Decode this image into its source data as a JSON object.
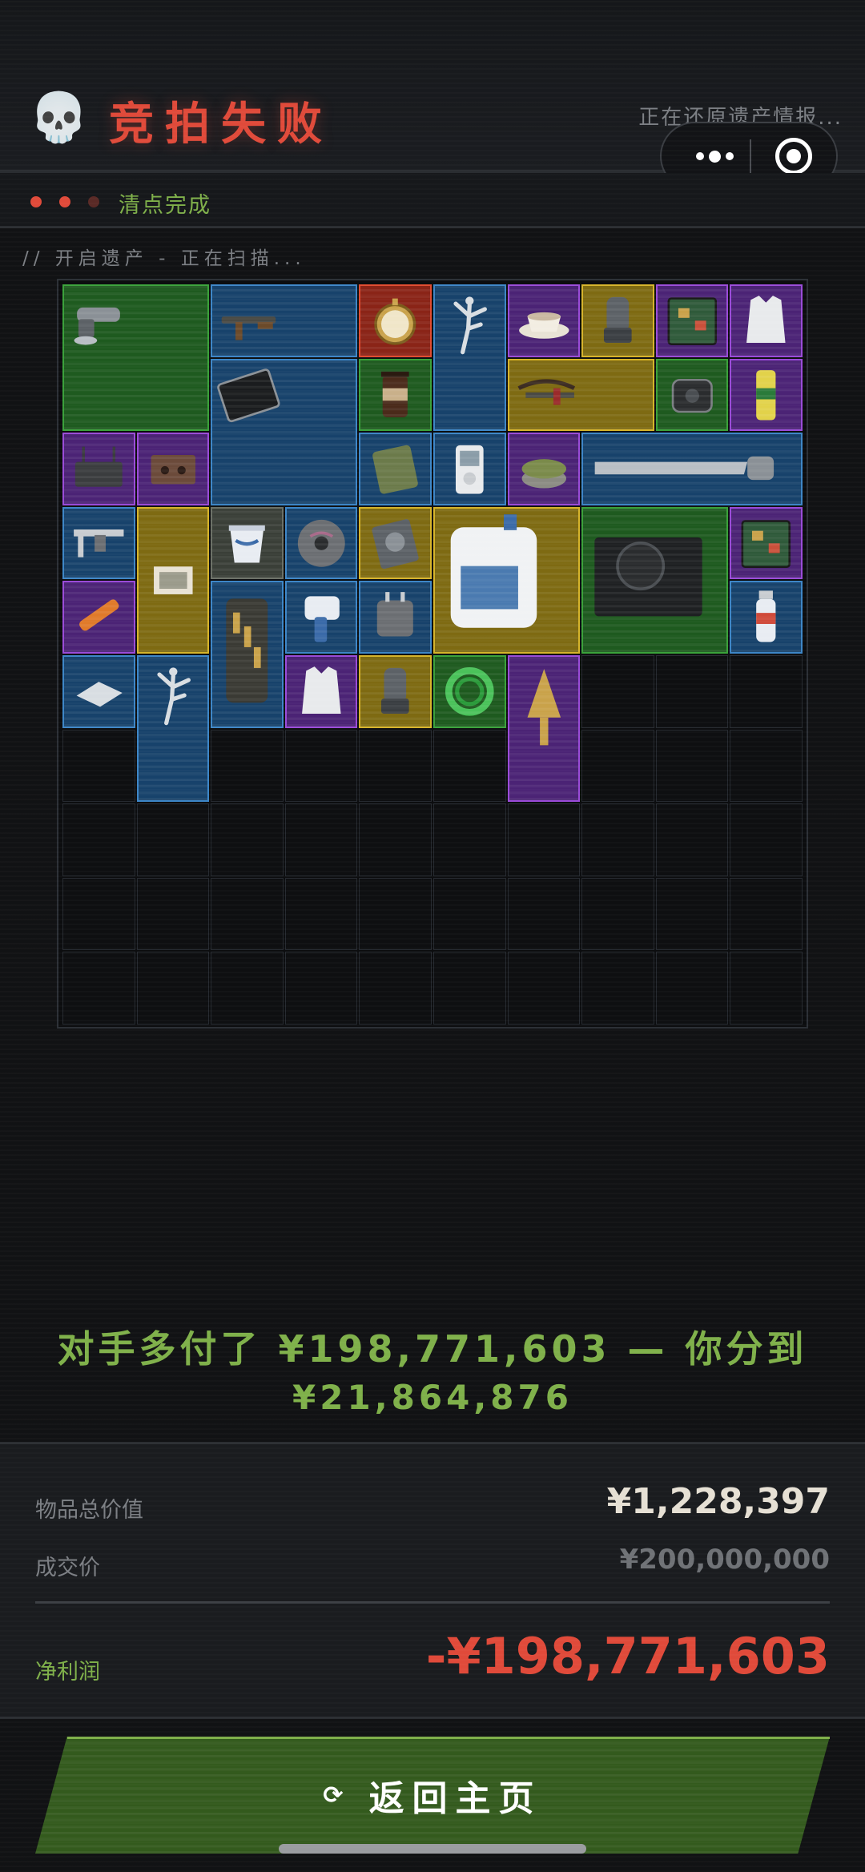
{
  "header": {
    "title": "竞拍失败",
    "skull_icon": "💀",
    "restore_status": "正在还原遗产情报..."
  },
  "status": {
    "text": "清点完成",
    "dot_colors": [
      "#e04a3a",
      "#e04a3a",
      "#5a2a26"
    ]
  },
  "scan_text": "// 开启遗产 - 正在扫描...",
  "inventory": {
    "columns": 10,
    "rows": 10,
    "items": [
      {
        "name": "angle-grinder",
        "rarity": "green",
        "col": 0,
        "row": 0,
        "w": 2,
        "h": 2
      },
      {
        "name": "assault-rifle",
        "rarity": "blue",
        "col": 2,
        "row": 0,
        "w": 2,
        "h": 1
      },
      {
        "name": "pocket-watch",
        "rarity": "red",
        "col": 4,
        "row": 0,
        "w": 1,
        "h": 1
      },
      {
        "name": "ballerina-statue",
        "rarity": "blue",
        "col": 5,
        "row": 0,
        "w": 1,
        "h": 2
      },
      {
        "name": "teacup",
        "rarity": "purple",
        "col": 6,
        "row": 0,
        "w": 1,
        "h": 1
      },
      {
        "name": "gas-mask-filter",
        "rarity": "gold",
        "col": 7,
        "row": 0,
        "w": 1,
        "h": 1
      },
      {
        "name": "circuit-board",
        "rarity": "purple",
        "col": 8,
        "row": 0,
        "w": 1,
        "h": 1
      },
      {
        "name": "body-armor-vest",
        "rarity": "purple",
        "col": 9,
        "row": 0,
        "w": 1,
        "h": 1
      },
      {
        "name": "tablet",
        "rarity": "blue",
        "col": 2,
        "row": 1,
        "w": 2,
        "h": 2
      },
      {
        "name": "coffee-jar",
        "rarity": "green",
        "col": 4,
        "row": 1,
        "w": 1,
        "h": 1
      },
      {
        "name": "crossbow",
        "rarity": "gold",
        "col": 6,
        "row": 1,
        "w": 2,
        "h": 1
      },
      {
        "name": "wireless-charger",
        "rarity": "green",
        "col": 8,
        "row": 1,
        "w": 1,
        "h": 1
      },
      {
        "name": "energy-drink-can",
        "rarity": "purple",
        "col": 9,
        "row": 1,
        "w": 1,
        "h": 1
      },
      {
        "name": "router",
        "rarity": "purple",
        "col": 0,
        "row": 2,
        "w": 1,
        "h": 1
      },
      {
        "name": "cassette-tape",
        "rarity": "purple",
        "col": 1,
        "row": 2,
        "w": 1,
        "h": 1
      },
      {
        "name": "ration-pack",
        "rarity": "blue",
        "col": 4,
        "row": 2,
        "w": 1,
        "h": 1
      },
      {
        "name": "mp3-player",
        "rarity": "blue",
        "col": 5,
        "row": 2,
        "w": 1,
        "h": 1
      },
      {
        "name": "canned-food",
        "rarity": "purple",
        "col": 6,
        "row": 2,
        "w": 1,
        "h": 1
      },
      {
        "name": "hand-saw",
        "rarity": "blue",
        "col": 7,
        "row": 2,
        "w": 3,
        "h": 1
      },
      {
        "name": "caliper",
        "rarity": "blue",
        "col": 0,
        "row": 3,
        "w": 1,
        "h": 1
      },
      {
        "name": "document-photo",
        "rarity": "gold",
        "col": 1,
        "row": 3,
        "w": 1,
        "h": 2
      },
      {
        "name": "yogurt-cup",
        "rarity": "gray",
        "col": 2,
        "row": 3,
        "w": 1,
        "h": 1
      },
      {
        "name": "cd-disc",
        "rarity": "blue",
        "col": 3,
        "row": 3,
        "w": 1,
        "h": 1
      },
      {
        "name": "hard-drive",
        "rarity": "gold",
        "col": 4,
        "row": 3,
        "w": 1,
        "h": 1
      },
      {
        "name": "fuel-jug",
        "rarity": "gold",
        "col": 5,
        "row": 3,
        "w": 2,
        "h": 2
      },
      {
        "name": "power-supply",
        "rarity": "green",
        "col": 7,
        "row": 3,
        "w": 2,
        "h": 2
      },
      {
        "name": "circuit-board",
        "rarity": "purple",
        "col": 9,
        "row": 3,
        "w": 1,
        "h": 1
      },
      {
        "name": "flare-tube",
        "rarity": "purple",
        "col": 0,
        "row": 4,
        "w": 1,
        "h": 1
      },
      {
        "name": "bullet-jar",
        "rarity": "blue",
        "col": 2,
        "row": 4,
        "w": 1,
        "h": 2
      },
      {
        "name": "thermometer-gun",
        "rarity": "blue",
        "col": 3,
        "row": 4,
        "w": 1,
        "h": 1
      },
      {
        "name": "travel-adapter",
        "rarity": "blue",
        "col": 4,
        "row": 4,
        "w": 1,
        "h": 1
      },
      {
        "name": "water-bottle",
        "rarity": "blue",
        "col": 9,
        "row": 4,
        "w": 1,
        "h": 1
      },
      {
        "name": "metal-plate",
        "rarity": "blue",
        "col": 0,
        "row": 5,
        "w": 1,
        "h": 1
      },
      {
        "name": "ballerina-statue",
        "rarity": "blue",
        "col": 1,
        "row": 5,
        "w": 1,
        "h": 2
      },
      {
        "name": "body-armor-vest",
        "rarity": "purple",
        "col": 3,
        "row": 5,
        "w": 1,
        "h": 1
      },
      {
        "name": "gas-mask-filter",
        "rarity": "gold",
        "col": 4,
        "row": 5,
        "w": 1,
        "h": 1
      },
      {
        "name": "green-cable-coil",
        "rarity": "green",
        "col": 5,
        "row": 5,
        "w": 1,
        "h": 1
      },
      {
        "name": "golden-pyramid-artifact",
        "rarity": "purple",
        "col": 6,
        "row": 5,
        "w": 1,
        "h": 2
      }
    ]
  },
  "message": {
    "line1": "对手多付了 ¥198,771,603 — 你分到",
    "line2": "¥21,864,876"
  },
  "stats": {
    "total_value_label": "物品总价值",
    "total_value": "¥1,228,397",
    "deal_price_label": "成交价",
    "deal_price": "¥200,000,000",
    "net_profit_label": "净利润",
    "net_profit": "-¥198,771,603"
  },
  "button": {
    "icon": "⟳",
    "label": "返回主页"
  },
  "colors": {
    "accent_red": "#e04a3a",
    "accent_green": "#7fb04a",
    "background": "#111214"
  }
}
